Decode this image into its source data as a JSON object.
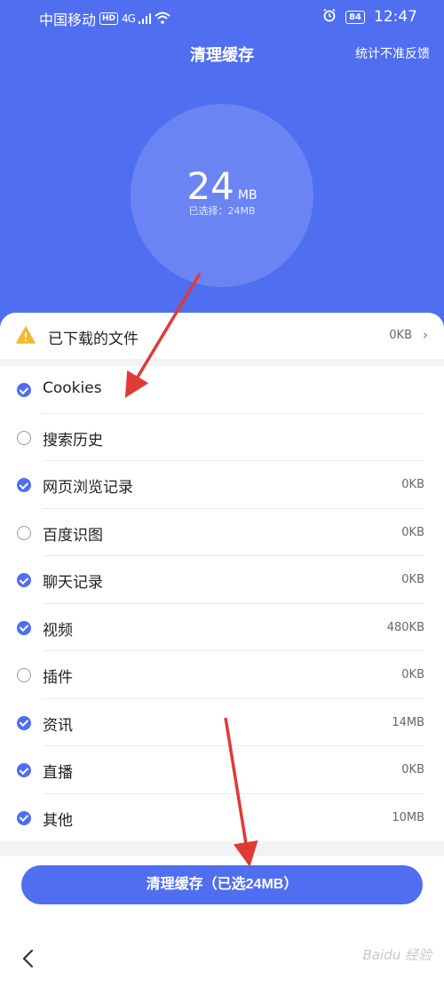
{
  "status_bar": {
    "carrier": "中国移动",
    "hd": "HD",
    "network": "4G",
    "battery": "84",
    "time": "12:47"
  },
  "header": {
    "title": "清理缓存",
    "feedback": "统计不准反馈"
  },
  "summary": {
    "size_value": "24",
    "size_unit": "MB",
    "selected_text": "已选择：24MB"
  },
  "downloads": {
    "label": "已下载的文件",
    "size": "0KB"
  },
  "items": [
    {
      "label": "Cookies",
      "size": "",
      "checked": true
    },
    {
      "label": "搜索历史",
      "size": "",
      "checked": false
    },
    {
      "label": "网页浏览记录",
      "size": "0KB",
      "checked": true
    },
    {
      "label": "百度识图",
      "size": "0KB",
      "checked": false
    },
    {
      "label": "聊天记录",
      "size": "0KB",
      "checked": true
    },
    {
      "label": "视频",
      "size": "480KB",
      "checked": true
    },
    {
      "label": "插件",
      "size": "0KB",
      "checked": false
    },
    {
      "label": "资讯",
      "size": "14MB",
      "checked": true
    },
    {
      "label": "直播",
      "size": "0KB",
      "checked": true
    },
    {
      "label": "其他",
      "size": "10MB",
      "checked": true
    }
  ],
  "action": {
    "clean_label": "清理缓存（已选24MB）"
  },
  "watermark": "Baidu 经验",
  "colors": {
    "accent": "#4f6ef0",
    "circle": "#6a85f3",
    "arrow": "#e03a35"
  }
}
